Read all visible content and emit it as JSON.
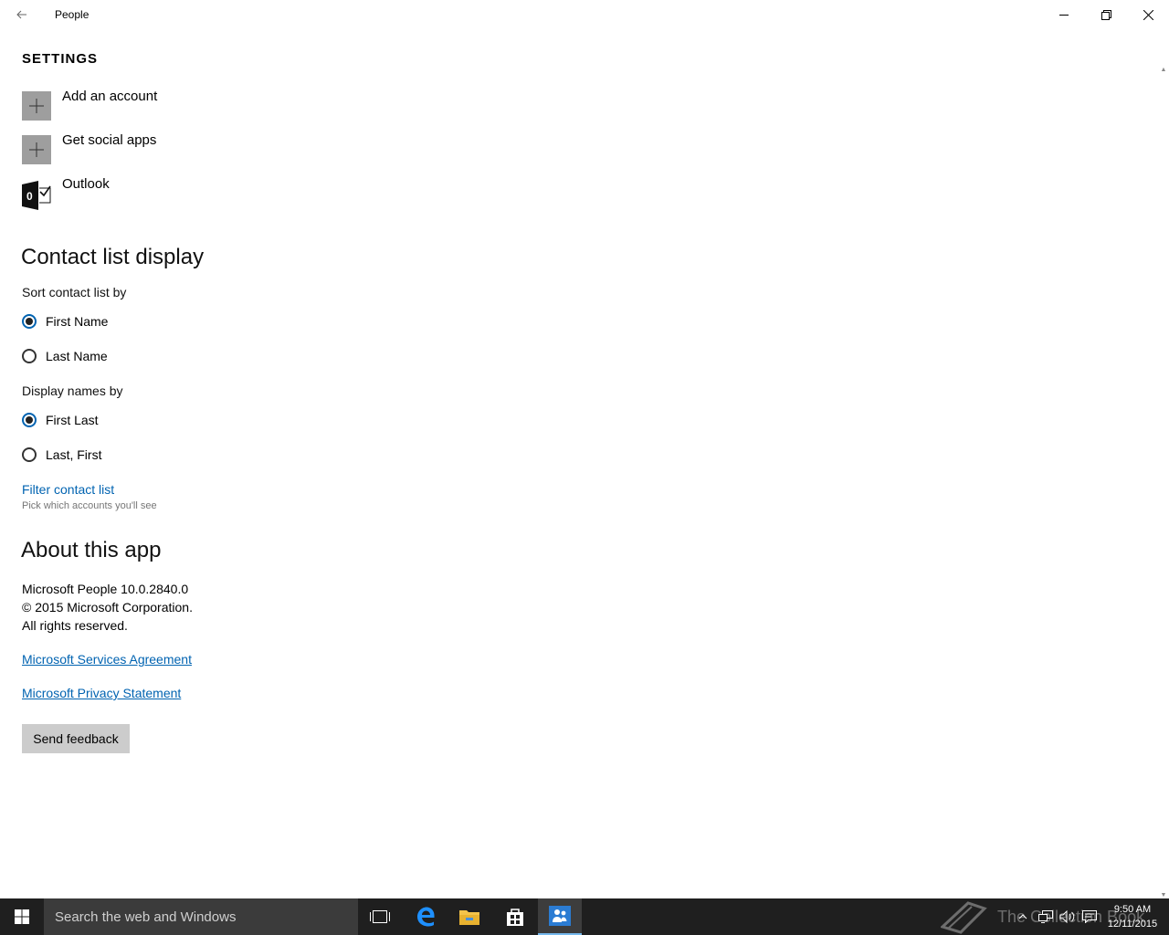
{
  "window": {
    "title": "People",
    "back_icon": "back-arrow-icon",
    "minimize_icon": "minimize-icon",
    "maximize_icon": "restore-icon",
    "close_icon": "close-icon"
  },
  "settings": {
    "heading": "SETTINGS",
    "accounts": [
      {
        "label": "Add an account",
        "icon": "plus-icon"
      },
      {
        "label": "Get social apps",
        "icon": "plus-icon"
      },
      {
        "label": "Outlook",
        "icon": "outlook-icon"
      }
    ]
  },
  "contact_list": {
    "heading": "Contact list display",
    "sort_label": "Sort contact list by",
    "sort_options": [
      {
        "label": "First Name",
        "checked": true
      },
      {
        "label": "Last Name",
        "checked": false
      }
    ],
    "display_label": "Display names by",
    "display_options": [
      {
        "label": "First Last",
        "checked": true
      },
      {
        "label": "Last, First",
        "checked": false
      }
    ],
    "filter_link": "Filter contact list",
    "filter_hint": "Pick which accounts you'll see"
  },
  "about": {
    "heading": "About this app",
    "version": "Microsoft People 10.0.2840.0",
    "copyright": "© 2015 Microsoft Corporation.",
    "rights": "All rights reserved.",
    "services_link": "Microsoft Services Agreement",
    "privacy_link": "Microsoft Privacy Statement",
    "feedback_button": "Send feedback"
  },
  "taskbar": {
    "search_placeholder": "Search the web and Windows",
    "watermark": "The Collection Book",
    "time": "9:50 AM",
    "date": "12/11/2015",
    "accent_color": "#76b9ed"
  },
  "colors": {
    "accent": "#0063b1",
    "taskbar": "#1f1f1f",
    "tile": "#9e9e9e"
  }
}
